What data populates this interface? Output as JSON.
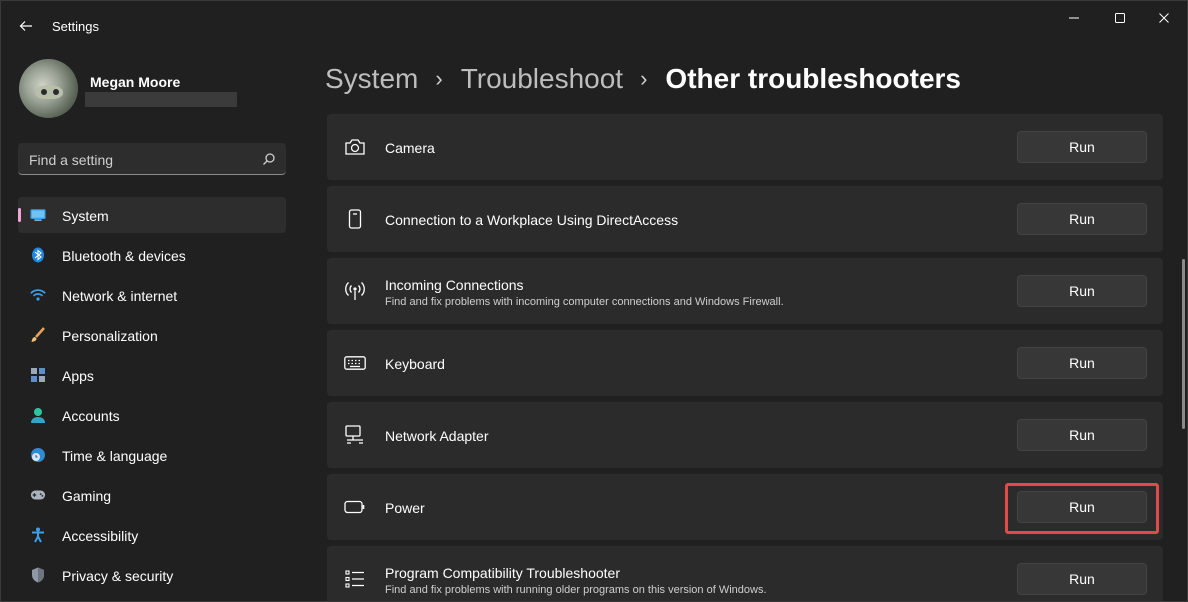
{
  "window": {
    "title": "Settings"
  },
  "profile": {
    "name": "Megan Moore"
  },
  "search": {
    "placeholder": "Find a setting"
  },
  "sidebar": {
    "items": [
      {
        "label": "System",
        "icon": "monitor-icon",
        "active": true
      },
      {
        "label": "Bluetooth & devices",
        "icon": "bluetooth-icon"
      },
      {
        "label": "Network & internet",
        "icon": "wifi-icon"
      },
      {
        "label": "Personalization",
        "icon": "brush-icon"
      },
      {
        "label": "Apps",
        "icon": "apps-icon"
      },
      {
        "label": "Accounts",
        "icon": "person-icon"
      },
      {
        "label": "Time & language",
        "icon": "globe-clock-icon"
      },
      {
        "label": "Gaming",
        "icon": "gamepad-icon"
      },
      {
        "label": "Accessibility",
        "icon": "accessibility-icon"
      },
      {
        "label": "Privacy & security",
        "icon": "shield-icon"
      }
    ]
  },
  "breadcrumb": {
    "items": [
      "System",
      "Troubleshoot",
      "Other troubleshooters"
    ],
    "separator": "›"
  },
  "troubleshooters": [
    {
      "title": "Camera",
      "description": "",
      "icon": "camera-icon",
      "button": "Run"
    },
    {
      "title": "Connection to a Workplace Using DirectAccess",
      "description": "",
      "icon": "phone-icon",
      "button": "Run"
    },
    {
      "title": "Incoming Connections",
      "description": "Find and fix problems with incoming computer connections and Windows Firewall.",
      "icon": "antenna-icon",
      "button": "Run"
    },
    {
      "title": "Keyboard",
      "description": "",
      "icon": "keyboard-icon",
      "button": "Run"
    },
    {
      "title": "Network Adapter",
      "description": "",
      "icon": "network-adapter-icon",
      "button": "Run"
    },
    {
      "title": "Power",
      "description": "",
      "icon": "battery-icon",
      "button": "Run",
      "highlighted": true
    },
    {
      "title": "Program Compatibility Troubleshooter",
      "description": "Find and fix problems with running older programs on this version of Windows.",
      "icon": "list-icon",
      "button": "Run"
    }
  ],
  "colors": {
    "accent": "#f0a5d6",
    "highlight": "#e04a4a",
    "background": "#202020",
    "card": "#2b2b2b"
  }
}
